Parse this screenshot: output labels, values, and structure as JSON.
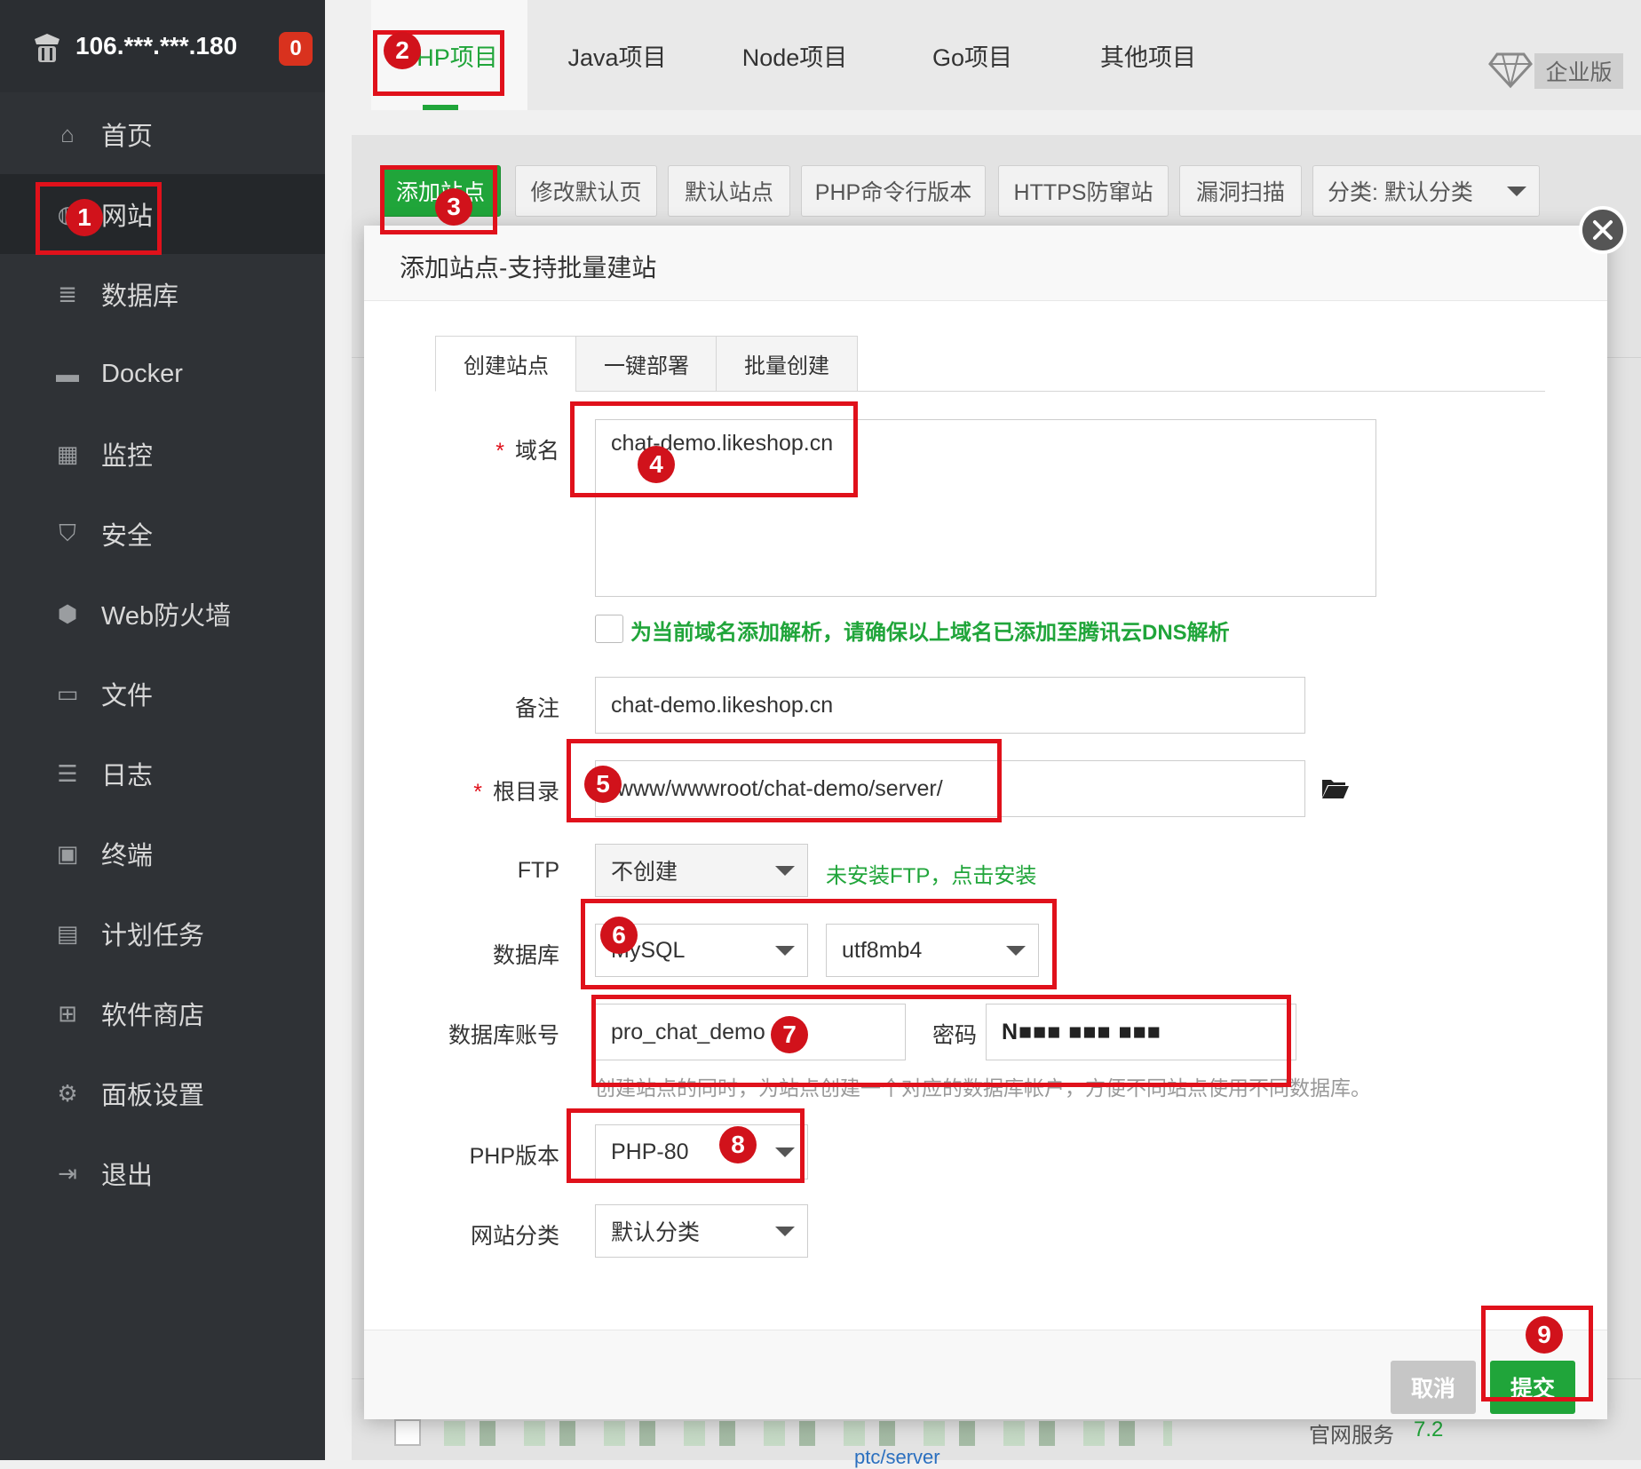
{
  "sidebar": {
    "server_ip": "106.***.***.180",
    "notification_count": "0",
    "items": [
      {
        "label": "首页",
        "icon": "home-icon"
      },
      {
        "label": "网站",
        "icon": "globe-icon"
      },
      {
        "label": "数据库",
        "icon": "database-icon"
      },
      {
        "label": "Docker",
        "icon": "docker-icon"
      },
      {
        "label": "监控",
        "icon": "monitor-icon"
      },
      {
        "label": "安全",
        "icon": "shield-icon"
      },
      {
        "label": "Web防火墙",
        "icon": "firewall-icon"
      },
      {
        "label": "文件",
        "icon": "folder-icon"
      },
      {
        "label": "日志",
        "icon": "log-icon"
      },
      {
        "label": "终端",
        "icon": "terminal-icon"
      },
      {
        "label": "计划任务",
        "icon": "calendar-icon"
      },
      {
        "label": "软件商店",
        "icon": "apps-icon"
      },
      {
        "label": "面板设置",
        "icon": "gear-icon"
      },
      {
        "label": "退出",
        "icon": "logout-icon"
      }
    ]
  },
  "project_tabs": [
    "PHP项目",
    "Java项目",
    "Node项目",
    "Go项目",
    "其他项目"
  ],
  "edition_label": "企业版",
  "toolbar": {
    "add_site": "添加站点",
    "modify_default_page": "修改默认页",
    "default_site": "默认站点",
    "php_cli_version": "PHP命令行版本",
    "https_protection": "HTTPS防窜站",
    "vuln_scan": "漏洞扫描",
    "category_select": "分类: 默认分类"
  },
  "modal": {
    "title": "添加站点-支持批量建站",
    "tabs": [
      "创建站点",
      "一键部署",
      "批量创建"
    ],
    "domain": {
      "label": "域名",
      "value": "chat-demo.likeshop.cn"
    },
    "dns_checkbox_text": "为当前域名添加解析，请确保以上域名已添加至腾讯云DNS解析",
    "remark": {
      "label": "备注",
      "value": "chat-demo.likeshop.cn"
    },
    "root_dir": {
      "label": "根目录",
      "value": "/www/wwwroot/chat-demo/server/"
    },
    "ftp": {
      "label": "FTP",
      "value": "不创建",
      "hint": "未安装FTP，点击安装"
    },
    "database": {
      "label": "数据库",
      "type": "MySQL",
      "charset": "utf8mb4"
    },
    "db_account": {
      "label": "数据库账号",
      "value": "pro_chat_demo",
      "password_label": "密码",
      "password_value": "N■■■ ■■■ ■■■"
    },
    "db_hint": "创建站点的同时，为站点创建一个对应的数据库帐户，方便不同站点使用不同数据库。",
    "php_version": {
      "label": "PHP版本",
      "value": "PHP-80"
    },
    "site_category": {
      "label": "网站分类",
      "value": "默认分类"
    },
    "cancel_button": "取消",
    "submit_button": "提交"
  },
  "background_row": {
    "col_service": "官网服务",
    "col_php": "7.2",
    "col_path": "ptc/server"
  },
  "annotation_numbers": [
    "1",
    "2",
    "3",
    "4",
    "5",
    "6",
    "7",
    "8",
    "9"
  ],
  "colors": {
    "accent_green": "#20a53a",
    "annotation_red": "#e0111b",
    "sidebar_bg": "#2f3236"
  }
}
